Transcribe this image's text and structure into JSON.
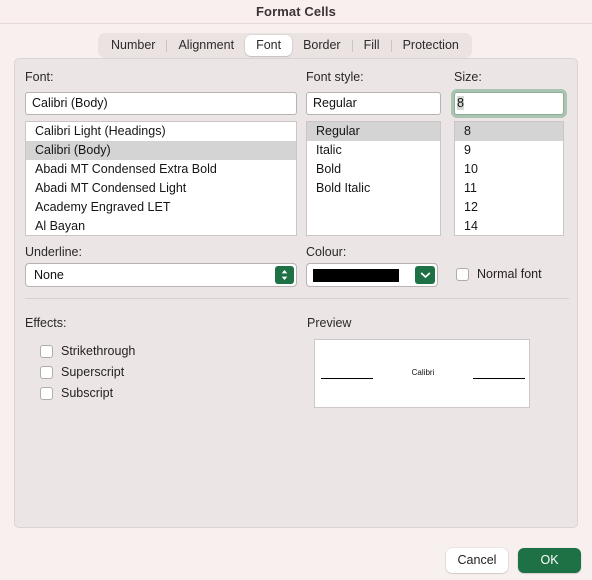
{
  "window": {
    "title": "Format Cells"
  },
  "tabs": [
    {
      "label": "Number",
      "selected": false
    },
    {
      "label": "Alignment",
      "selected": false
    },
    {
      "label": "Font",
      "selected": true
    },
    {
      "label": "Border",
      "selected": false
    },
    {
      "label": "Fill",
      "selected": false
    },
    {
      "label": "Protection",
      "selected": false
    }
  ],
  "font": {
    "label": "Font:",
    "value": "Calibri (Body)",
    "options": [
      "Calibri Light (Headings)",
      "Calibri (Body)",
      "Abadi MT Condensed Extra Bold",
      "Abadi MT Condensed Light",
      "Academy Engraved LET",
      "Al Bayan"
    ],
    "selected": "Calibri (Body)"
  },
  "font_style": {
    "label": "Font style:",
    "value": "Regular",
    "options": [
      "Regular",
      "Italic",
      "Bold",
      "Bold Italic"
    ],
    "selected": "Regular"
  },
  "size": {
    "label": "Size:",
    "value": "8",
    "options": [
      "8",
      "9",
      "10",
      "11",
      "12",
      "14"
    ],
    "selected": "8"
  },
  "underline": {
    "label": "Underline:",
    "value": "None"
  },
  "colour": {
    "label": "Colour:",
    "value": "#000000"
  },
  "normal_font": {
    "label": "Normal font",
    "checked": false
  },
  "effects": {
    "label": "Effects:",
    "items": [
      {
        "label": "Strikethrough",
        "checked": false
      },
      {
        "label": "Superscript",
        "checked": false
      },
      {
        "label": "Subscript",
        "checked": false
      }
    ]
  },
  "preview": {
    "label": "Preview",
    "sample_text": "Calibri"
  },
  "buttons": {
    "cancel": "Cancel",
    "ok": "OK"
  },
  "colors": {
    "accent_green": "#1e7145",
    "dialog_background": "#f8efef",
    "panel_background": "#ece5e5"
  }
}
